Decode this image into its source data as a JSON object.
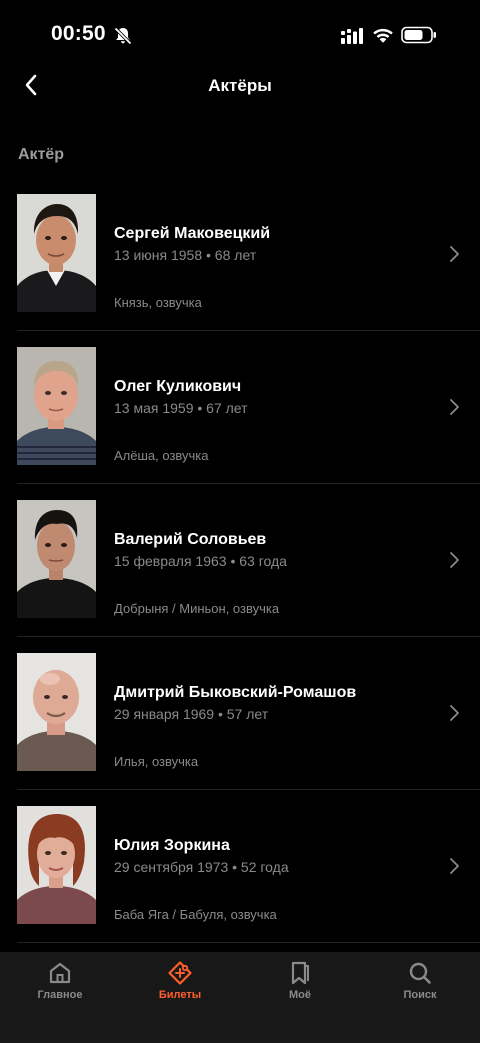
{
  "status_bar": {
    "time": "00:50"
  },
  "header": {
    "title": "Актёры",
    "back_icon": "chevron-left-icon"
  },
  "section": {
    "title": "Актёр"
  },
  "actors": [
    {
      "name": "Сергей Маковецкий",
      "birth": "13 июня 1958 • 68 лет",
      "role": "Князь, озвучка"
    },
    {
      "name": "Олег Куликович",
      "birth": "13 мая 1959 • 67 лет",
      "role": "Алёша, озвучка"
    },
    {
      "name": "Валерий Соловьев",
      "birth": "15 февраля 1963 • 63 года",
      "role": "Добрыня / Миньон, озвучка"
    },
    {
      "name": "Дмитрий Быковский-Ромашов",
      "birth": "29 января 1969 • 57 лет",
      "role": "Илья, озвучка"
    },
    {
      "name": "Юлия Зоркина",
      "birth": "29 сентября 1973 • 52 года",
      "role": "Баба Яга / Бабуля, озвучка"
    }
  ],
  "tabs": [
    {
      "label": "Главное",
      "icon": "home-icon",
      "active": false
    },
    {
      "label": "Билеты",
      "icon": "ticket-icon",
      "active": true
    },
    {
      "label": "Моё",
      "icon": "bookmark-icon",
      "active": false
    },
    {
      "label": "Поиск",
      "icon": "search-icon",
      "active": false
    }
  ],
  "colors": {
    "background": "#000000",
    "accent": "#ff5f2a",
    "secondary_text": "#8a8a8a",
    "tab_bar": "#181818"
  }
}
